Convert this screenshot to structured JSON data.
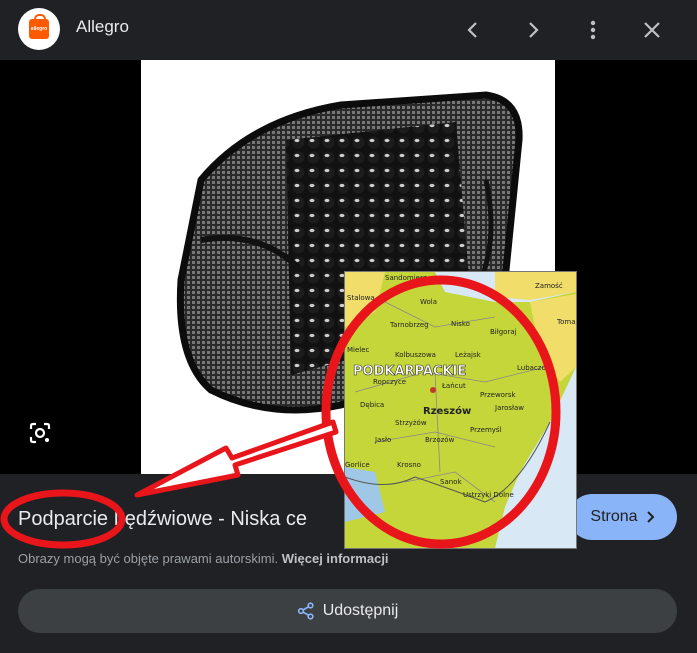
{
  "header": {
    "app_title": "Allegro",
    "logo_text": "allegro",
    "icons": [
      "chevron-left-icon",
      "chevron-right-icon",
      "more-vert-icon",
      "close-icon"
    ]
  },
  "map": {
    "region_label": "PODKARPACKIE",
    "capital": "Rzeszów",
    "places": [
      "Sandomierz",
      "Zamość",
      "Stalowa",
      "Wola",
      "Tarnobrzeg",
      "Nisko",
      "Biłgoraj",
      "Tomaszów Lubelski",
      "Mielec",
      "Kolbuszowa",
      "Leżajsk",
      "Lubaczów",
      "Ropczyce",
      "Łańcut",
      "Przeworsk",
      "Jarosław",
      "Dębica",
      "Strzyżów",
      "Przemyśl",
      "Jasło",
      "Brzozów",
      "Gorlice",
      "Krosno",
      "Sanok",
      "Ustrzyki Dolne"
    ]
  },
  "result": {
    "title": "Podparcie Lędźwiowe - Niska ce",
    "site_button": "Strona",
    "copyright_text": "Obrazy mogą być objęte prawami autorskimi.",
    "copyright_link": "Więcej informacji",
    "share_button": "Udostępnij"
  },
  "colors": {
    "background": "#202124",
    "accent": "#8ab4f8",
    "annotation_red": "#e8151b",
    "map_green": "#c5d63a"
  }
}
